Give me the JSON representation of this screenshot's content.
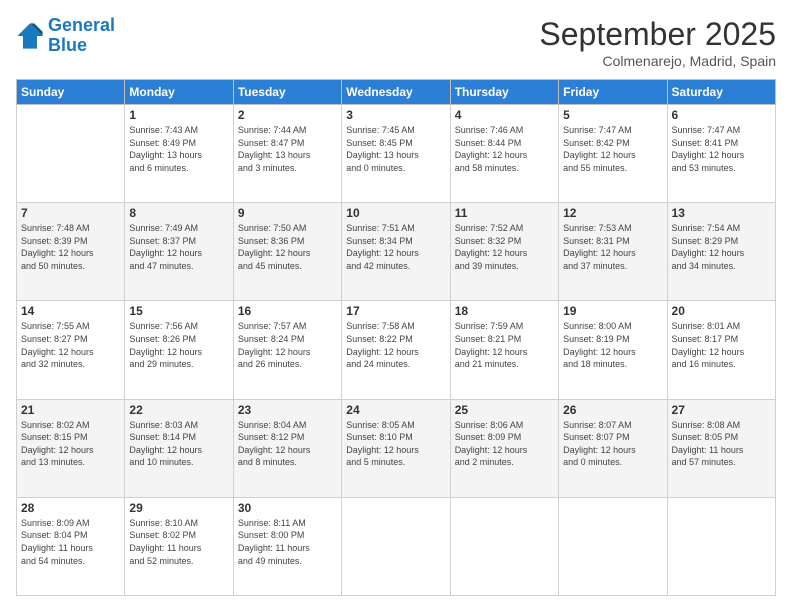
{
  "logo": {
    "line1": "General",
    "line2": "Blue"
  },
  "header": {
    "month": "September 2025",
    "location": "Colmenarejo, Madrid, Spain"
  },
  "weekdays": [
    "Sunday",
    "Monday",
    "Tuesday",
    "Wednesday",
    "Thursday",
    "Friday",
    "Saturday"
  ],
  "weeks": [
    [
      {
        "day": "",
        "info": ""
      },
      {
        "day": "1",
        "info": "Sunrise: 7:43 AM\nSunset: 8:49 PM\nDaylight: 13 hours\nand 6 minutes."
      },
      {
        "day": "2",
        "info": "Sunrise: 7:44 AM\nSunset: 8:47 PM\nDaylight: 13 hours\nand 3 minutes."
      },
      {
        "day": "3",
        "info": "Sunrise: 7:45 AM\nSunset: 8:45 PM\nDaylight: 13 hours\nand 0 minutes."
      },
      {
        "day": "4",
        "info": "Sunrise: 7:46 AM\nSunset: 8:44 PM\nDaylight: 12 hours\nand 58 minutes."
      },
      {
        "day": "5",
        "info": "Sunrise: 7:47 AM\nSunset: 8:42 PM\nDaylight: 12 hours\nand 55 minutes."
      },
      {
        "day": "6",
        "info": "Sunrise: 7:47 AM\nSunset: 8:41 PM\nDaylight: 12 hours\nand 53 minutes."
      }
    ],
    [
      {
        "day": "7",
        "info": "Sunrise: 7:48 AM\nSunset: 8:39 PM\nDaylight: 12 hours\nand 50 minutes."
      },
      {
        "day": "8",
        "info": "Sunrise: 7:49 AM\nSunset: 8:37 PM\nDaylight: 12 hours\nand 47 minutes."
      },
      {
        "day": "9",
        "info": "Sunrise: 7:50 AM\nSunset: 8:36 PM\nDaylight: 12 hours\nand 45 minutes."
      },
      {
        "day": "10",
        "info": "Sunrise: 7:51 AM\nSunset: 8:34 PM\nDaylight: 12 hours\nand 42 minutes."
      },
      {
        "day": "11",
        "info": "Sunrise: 7:52 AM\nSunset: 8:32 PM\nDaylight: 12 hours\nand 39 minutes."
      },
      {
        "day": "12",
        "info": "Sunrise: 7:53 AM\nSunset: 8:31 PM\nDaylight: 12 hours\nand 37 minutes."
      },
      {
        "day": "13",
        "info": "Sunrise: 7:54 AM\nSunset: 8:29 PM\nDaylight: 12 hours\nand 34 minutes."
      }
    ],
    [
      {
        "day": "14",
        "info": "Sunrise: 7:55 AM\nSunset: 8:27 PM\nDaylight: 12 hours\nand 32 minutes."
      },
      {
        "day": "15",
        "info": "Sunrise: 7:56 AM\nSunset: 8:26 PM\nDaylight: 12 hours\nand 29 minutes."
      },
      {
        "day": "16",
        "info": "Sunrise: 7:57 AM\nSunset: 8:24 PM\nDaylight: 12 hours\nand 26 minutes."
      },
      {
        "day": "17",
        "info": "Sunrise: 7:58 AM\nSunset: 8:22 PM\nDaylight: 12 hours\nand 24 minutes."
      },
      {
        "day": "18",
        "info": "Sunrise: 7:59 AM\nSunset: 8:21 PM\nDaylight: 12 hours\nand 21 minutes."
      },
      {
        "day": "19",
        "info": "Sunrise: 8:00 AM\nSunset: 8:19 PM\nDaylight: 12 hours\nand 18 minutes."
      },
      {
        "day": "20",
        "info": "Sunrise: 8:01 AM\nSunset: 8:17 PM\nDaylight: 12 hours\nand 16 minutes."
      }
    ],
    [
      {
        "day": "21",
        "info": "Sunrise: 8:02 AM\nSunset: 8:15 PM\nDaylight: 12 hours\nand 13 minutes."
      },
      {
        "day": "22",
        "info": "Sunrise: 8:03 AM\nSunset: 8:14 PM\nDaylight: 12 hours\nand 10 minutes."
      },
      {
        "day": "23",
        "info": "Sunrise: 8:04 AM\nSunset: 8:12 PM\nDaylight: 12 hours\nand 8 minutes."
      },
      {
        "day": "24",
        "info": "Sunrise: 8:05 AM\nSunset: 8:10 PM\nDaylight: 12 hours\nand 5 minutes."
      },
      {
        "day": "25",
        "info": "Sunrise: 8:06 AM\nSunset: 8:09 PM\nDaylight: 12 hours\nand 2 minutes."
      },
      {
        "day": "26",
        "info": "Sunrise: 8:07 AM\nSunset: 8:07 PM\nDaylight: 12 hours\nand 0 minutes."
      },
      {
        "day": "27",
        "info": "Sunrise: 8:08 AM\nSunset: 8:05 PM\nDaylight: 11 hours\nand 57 minutes."
      }
    ],
    [
      {
        "day": "28",
        "info": "Sunrise: 8:09 AM\nSunset: 8:04 PM\nDaylight: 11 hours\nand 54 minutes."
      },
      {
        "day": "29",
        "info": "Sunrise: 8:10 AM\nSunset: 8:02 PM\nDaylight: 11 hours\nand 52 minutes."
      },
      {
        "day": "30",
        "info": "Sunrise: 8:11 AM\nSunset: 8:00 PM\nDaylight: 11 hours\nand 49 minutes."
      },
      {
        "day": "",
        "info": ""
      },
      {
        "day": "",
        "info": ""
      },
      {
        "day": "",
        "info": ""
      },
      {
        "day": "",
        "info": ""
      }
    ]
  ]
}
